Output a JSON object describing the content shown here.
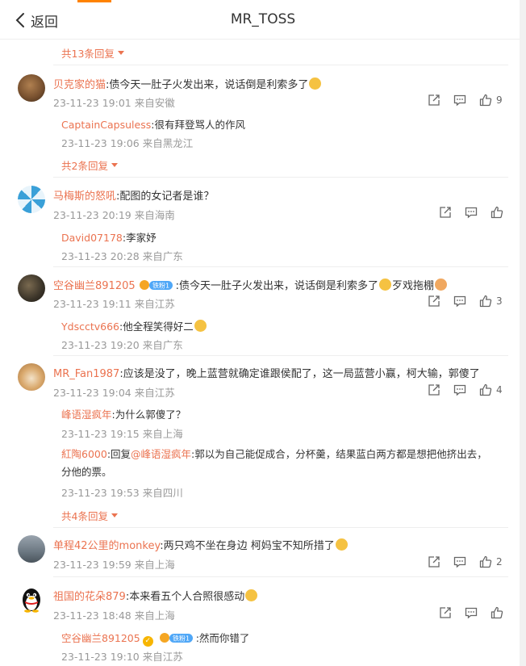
{
  "header": {
    "back_label": "返回",
    "title": "MR_TOSS"
  },
  "top_expand": "共13条回复",
  "comments": [
    {
      "user": "贝克家的猫",
      "text": ":债今天一肚子火发出来，说话倒是利索多了",
      "meta": "23-11-23 19:01 来自安徽",
      "likes": "9",
      "replies": [
        {
          "user": "CaptainCapsuless",
          "text": ":很有拜登骂人的作风",
          "meta": "23-11-23 19:06 来自黑龙江"
        }
      ],
      "expand": "共2条回复"
    },
    {
      "user": "马梅斯的怒吼",
      "text": ":配图的女记者是谁？",
      "meta": "23-11-23 20:19 来自海南",
      "likes": "",
      "replies": [
        {
          "user": "David07178",
          "text": ":李家妤",
          "meta": "23-11-23 20:28 来自广东"
        }
      ]
    },
    {
      "user": "空谷幽兰891205",
      "text": ":债今天一肚子火发出来，说话倒是利索多了",
      "text_tail": "歹戏拖棚",
      "badge_text": "铁粉1",
      "meta": "23-11-23 19:11 来自江苏",
      "likes": "3",
      "replies": [
        {
          "user": "Ydscctv666",
          "text": ":他全程笑得好二",
          "meta": "23-11-23 19:20 来自广东"
        }
      ]
    },
    {
      "user": "MR_Fan1987",
      "text": ":应该是没了，晚上蓝营就确定谁跟侯配了，这一局蓝营小赢，柯大输，郭傻了",
      "meta": "23-11-23 19:04 来自江苏",
      "likes": "4",
      "replies": [
        {
          "user": "峰语湿疯年",
          "text": ":为什么郭傻了？",
          "meta": "23-11-23 19:15 来自上海"
        },
        {
          "user": "紅陶6000",
          "text_prefix": ":回复",
          "mention": "@峰语湿疯年",
          "text": ":郭以为自己能促成合，分杯羹，结果蓝白两方都是想把他挤出去，分他的票。",
          "meta": "23-11-23 19:53 来自四川"
        }
      ],
      "expand": "共4条回复"
    },
    {
      "user": "单程42公里的monkey",
      "text": ":两只鸡不坐在身边 柯妈宝不知所措了",
      "meta": "23-11-23 19:59 来自上海",
      "likes": "2",
      "replies": []
    },
    {
      "user": "祖国的花朵879",
      "text": ":本来看五个人合照很感动",
      "meta": "23-11-23 18:48 来自上海",
      "likes": "",
      "replies": [
        {
          "user": "空谷幽兰891205",
          "badge_text": "铁粉1",
          "text": ":然而你错了",
          "meta": "23-11-23 19:10 来自江苏"
        }
      ]
    }
  ],
  "icons": {
    "share": "share-icon",
    "comment": "comment-icon",
    "like": "like-icon"
  },
  "colors": {
    "username": "#eb7350",
    "meta": "#999999",
    "accent": "#ff8200",
    "badge_blue": "#4fa7f7"
  }
}
